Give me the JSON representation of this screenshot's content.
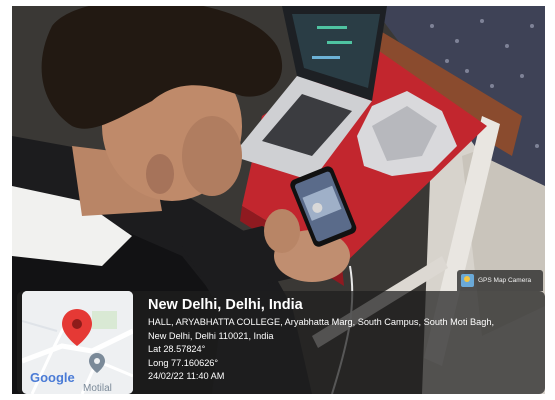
{
  "watermark": {
    "app_label": "GPS Map Camera",
    "icon": "gps-map-camera-logo-icon"
  },
  "location": {
    "city": "New Delhi, Delhi, India",
    "address_line1": "HALL, ARYABHATTA COLLEGE, Aryabhatta Marg, South Campus, South Moti Bagh,",
    "address_line2": "New Delhi, Delhi 110021, India",
    "lat": "Lat 28.57824°",
    "long": "Long 77.160626°",
    "datetime": "24/02/22 11:40 AM"
  },
  "map": {
    "brand": "Google",
    "place_label": "Motilal",
    "pin_color": "#e53935",
    "icons": [
      "map-pin-icon",
      "place-pin-icon"
    ]
  },
  "colors": {
    "panel_bg": "#1e1e1e",
    "table_red": "#c2262e",
    "shirt_black": "#1c1c1e"
  }
}
